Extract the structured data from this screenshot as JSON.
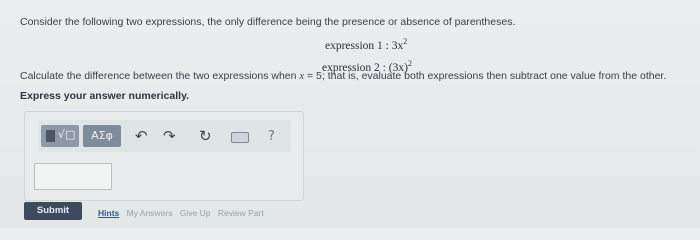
{
  "problem": {
    "intro": "Consider the following two expressions, the only difference being the presence or absence of parentheses.",
    "expression1": {
      "label": "expression 1 :",
      "body": "3x",
      "exponent": "2"
    },
    "expression2": {
      "label": "expression 2 :",
      "body": "(3x)",
      "exponent": "2"
    },
    "calculate_part1": "Calculate the difference between the two expressions when ",
    "calculate_var": "x",
    "calculate_part2": " = 5; that is, evaluate both expressions then subtract one value from the other.",
    "instruction": "Express your answer numerically."
  },
  "toolbar": {
    "template_symbol": "√□",
    "greek_label": "ΑΣφ",
    "undo_symbol": "↶",
    "redo_symbol": "↷",
    "reset_symbol": "↻",
    "help_symbol": "?"
  },
  "answer": {
    "value": ""
  },
  "actions": {
    "submit_label": "Submit",
    "hints_label": "Hints",
    "my_answers_label": "My Answers",
    "give_up_label": "Give Up",
    "review_part_label": "Review Part"
  }
}
